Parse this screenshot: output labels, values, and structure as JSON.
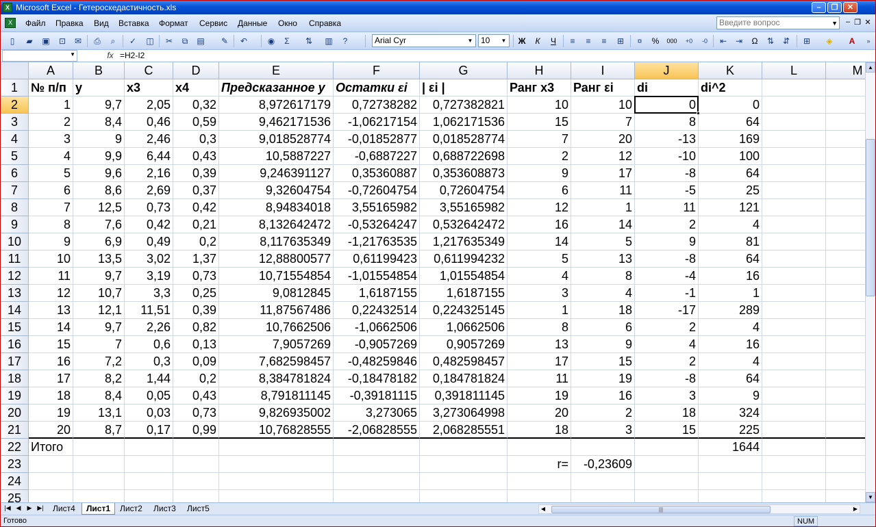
{
  "app": {
    "title": "Microsoft Excel - Гетероскедастичность.xls",
    "menus": [
      "Файл",
      "Правка",
      "Вид",
      "Вставка",
      "Формат",
      "Сервис",
      "Данные",
      "Окно",
      "Справка"
    ],
    "help_placeholder": "Введите вопрос"
  },
  "toolbar": {
    "font_name": "Arial Cyr",
    "font_size": "10"
  },
  "formula_bar": {
    "cell_ref": "",
    "fx_label": "fx",
    "formula": "=H2-I2"
  },
  "columns": [
    "A",
    "B",
    "C",
    "D",
    "E",
    "F",
    "G",
    "H",
    "I",
    "J",
    "K",
    "L",
    "M"
  ],
  "selected_column": "J",
  "selected_row": "2",
  "row_numbers": [
    "1",
    "2",
    "3",
    "4",
    "5",
    "6",
    "7",
    "8",
    "9",
    "10",
    "11",
    "12",
    "13",
    "14",
    "15",
    "16",
    "17",
    "18",
    "19",
    "20",
    "21",
    "22",
    "23",
    "24",
    "25"
  ],
  "headers": [
    "№ п/п",
    "y",
    "x3",
    "x4",
    "Предсказанное y",
    "Остатки εi",
    "| εi |",
    "Ранг x3",
    "Ранг εi",
    "di",
    "di^2"
  ],
  "rows": [
    [
      "1",
      "9,7",
      "2,05",
      "0,32",
      "8,972617179",
      "0,72738282",
      "0,727382821",
      "10",
      "10",
      "0",
      "0"
    ],
    [
      "2",
      "8,4",
      "0,46",
      "0,59",
      "9,462171536",
      "-1,06217154",
      "1,062171536",
      "15",
      "7",
      "8",
      "64"
    ],
    [
      "3",
      "9",
      "2,46",
      "0,3",
      "9,018528774",
      "-0,01852877",
      "0,018528774",
      "7",
      "20",
      "-13",
      "169"
    ],
    [
      "4",
      "9,9",
      "6,44",
      "0,43",
      "10,5887227",
      "-0,6887227",
      "0,688722698",
      "2",
      "12",
      "-10",
      "100"
    ],
    [
      "5",
      "9,6",
      "2,16",
      "0,39",
      "9,246391127",
      "0,35360887",
      "0,353608873",
      "9",
      "17",
      "-8",
      "64"
    ],
    [
      "6",
      "8,6",
      "2,69",
      "0,37",
      "9,32604754",
      "-0,72604754",
      "0,72604754",
      "6",
      "11",
      "-5",
      "25"
    ],
    [
      "7",
      "12,5",
      "0,73",
      "0,42",
      "8,94834018",
      "3,55165982",
      "3,55165982",
      "12",
      "1",
      "11",
      "121"
    ],
    [
      "8",
      "7,6",
      "0,42",
      "0,21",
      "8,132642472",
      "-0,53264247",
      "0,532642472",
      "16",
      "14",
      "2",
      "4"
    ],
    [
      "9",
      "6,9",
      "0,49",
      "0,2",
      "8,117635349",
      "-1,21763535",
      "1,217635349",
      "14",
      "5",
      "9",
      "81"
    ],
    [
      "10",
      "13,5",
      "3,02",
      "1,37",
      "12,88800577",
      "0,61199423",
      "0,611994232",
      "5",
      "13",
      "-8",
      "64"
    ],
    [
      "11",
      "9,7",
      "3,19",
      "0,73",
      "10,71554854",
      "-1,01554854",
      "1,01554854",
      "4",
      "8",
      "-4",
      "16"
    ],
    [
      "12",
      "10,7",
      "3,3",
      "0,25",
      "9,0812845",
      "1,6187155",
      "1,6187155",
      "3",
      "4",
      "-1",
      "1"
    ],
    [
      "13",
      "12,1",
      "11,51",
      "0,39",
      "11,87567486",
      "0,22432514",
      "0,224325145",
      "1",
      "18",
      "-17",
      "289"
    ],
    [
      "14",
      "9,7",
      "2,26",
      "0,82",
      "10,7662506",
      "-1,0662506",
      "1,0662506",
      "8",
      "6",
      "2",
      "4"
    ],
    [
      "15",
      "7",
      "0,6",
      "0,13",
      "7,9057269",
      "-0,9057269",
      "0,9057269",
      "13",
      "9",
      "4",
      "16"
    ],
    [
      "16",
      "7,2",
      "0,3",
      "0,09",
      "7,682598457",
      "-0,48259846",
      "0,482598457",
      "17",
      "15",
      "2",
      "4"
    ],
    [
      "17",
      "8,2",
      "1,44",
      "0,2",
      "8,384781824",
      "-0,18478182",
      "0,184781824",
      "11",
      "19",
      "-8",
      "64"
    ],
    [
      "18",
      "8,4",
      "0,05",
      "0,43",
      "8,791811145",
      "-0,39181115",
      "0,391811145",
      "19",
      "16",
      "3",
      "9"
    ],
    [
      "19",
      "13,1",
      "0,03",
      "0,73",
      "9,826935002",
      "3,273065",
      "3,273064998",
      "20",
      "2",
      "18",
      "324"
    ],
    [
      "20",
      "8,7",
      "0,17",
      "0,99",
      "10,76828555",
      "-2,06828555",
      "2,068285551",
      "18",
      "3",
      "15",
      "225"
    ]
  ],
  "totals": {
    "label": "Итого",
    "sum_di2": "1644"
  },
  "correlation": {
    "label": "r=",
    "value": "-0,23609"
  },
  "sheets": [
    "Лист4",
    "Лист1",
    "Лист2",
    "Лист3",
    "Лист5"
  ],
  "active_sheet": "Лист1",
  "status": {
    "ready": "Готово",
    "num": "NUM"
  }
}
